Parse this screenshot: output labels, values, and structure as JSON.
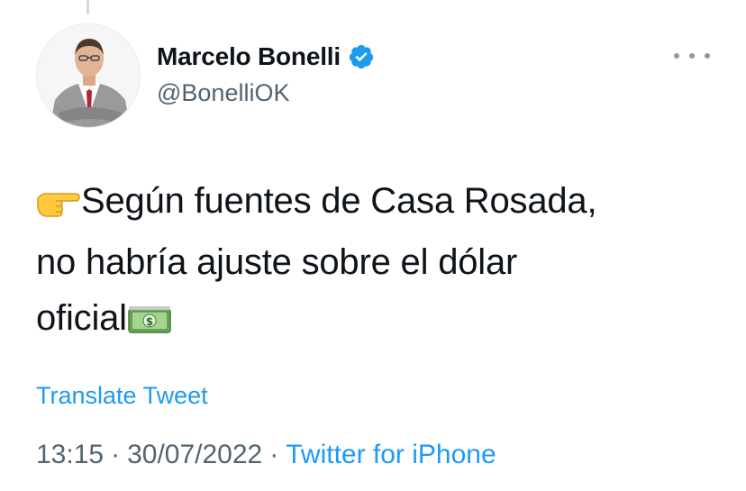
{
  "author": {
    "display_name": "Marcelo Bonelli",
    "handle": "@BonelliOK",
    "verified": true
  },
  "tweet": {
    "pointer_emoji": "point-right-emoji",
    "line1": "Según fuentes de Casa Rosada,",
    "line2": "no habría ajuste sobre el dólar",
    "line3": "oficial",
    "money_emoji": "dollar-banknote-emoji"
  },
  "translate_label": "Translate Tweet",
  "meta": {
    "time": "13:15",
    "separator": "·",
    "date": "30/07/2022",
    "source": "Twitter for iPhone"
  },
  "colors": {
    "text": "#0f1419",
    "secondary": "#536471",
    "link": "#1d9bf0",
    "verified": "#1d9bf0"
  }
}
